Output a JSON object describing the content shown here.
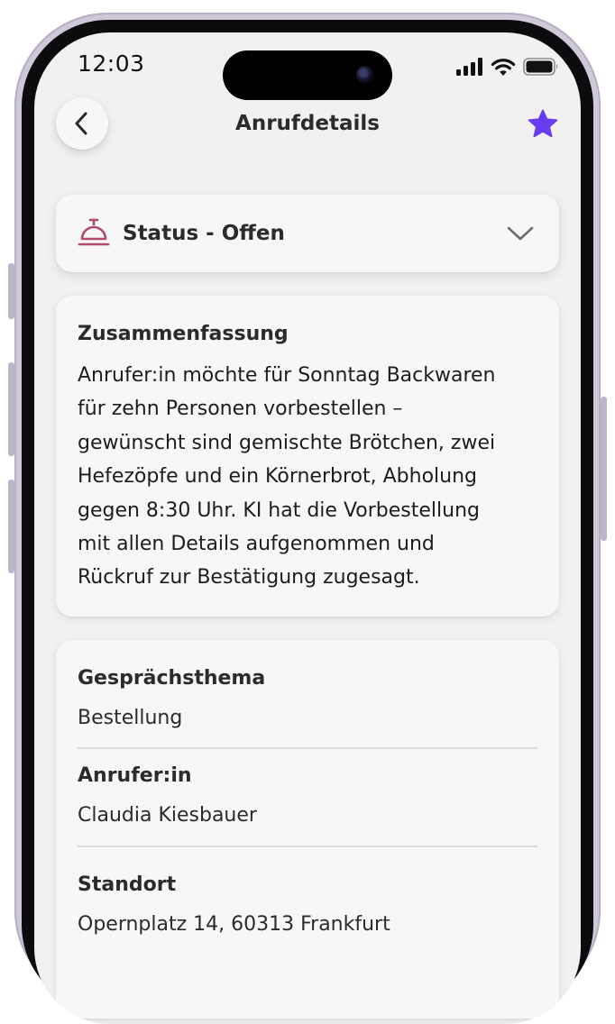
{
  "status_bar": {
    "time": "12:03"
  },
  "header": {
    "title": "Anrufdetails",
    "back_icon": "chevron-left-icon",
    "favorite_icon": "star-icon",
    "accent": "#6a3cf0"
  },
  "status": {
    "label": "Status - Offen",
    "icon": "bell-icon",
    "icon_color": "#b04a6e"
  },
  "summary": {
    "heading": "Zusammenfassung",
    "lines": [
      "Anrufer:in möchte für Sonntag Backwaren",
      "für zehn Personen vorbestellen –",
      "gewünscht sind gemischte Brötchen, zwei",
      "Hefezöpfe und ein Körnerbrot, Abholung",
      "gegen 8:30 Uhr. KI hat die Vorbestellung",
      "mit allen Details aufgenommen und",
      "Rückruf zur Bestätigung zugesagt."
    ]
  },
  "details": [
    {
      "label": "Gesprächsthema",
      "value": "Bestellung"
    },
    {
      "label": "Anrufer:in",
      "value": "Claudia Kiesbauer"
    },
    {
      "label": "Standort",
      "value": "Opernplatz 14, 60313 Frankfurt"
    }
  ]
}
